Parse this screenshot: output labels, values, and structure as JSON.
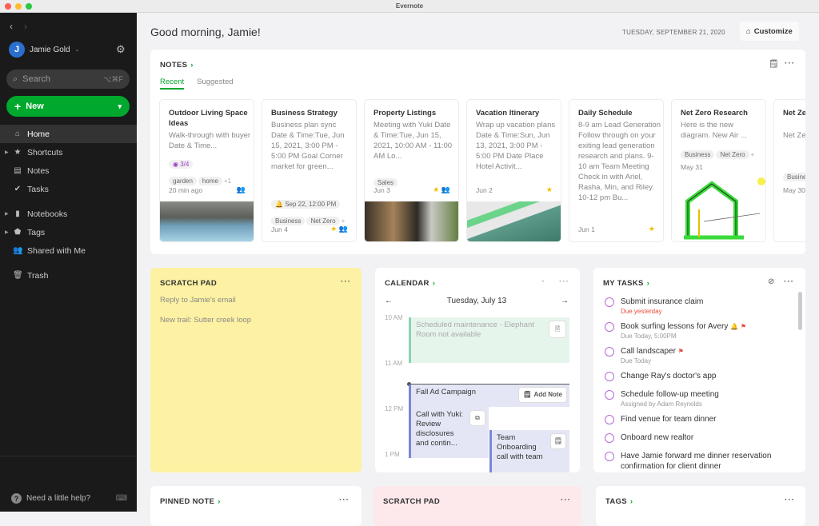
{
  "window": {
    "title": "Evernote"
  },
  "sidebar": {
    "user_initial": "J",
    "user_name": "Jamie Gold",
    "search_placeholder": "Search",
    "search_shortcut": "⌥⌘F",
    "new_label": "New",
    "items": [
      {
        "label": "Home",
        "icon": "home-icon"
      },
      {
        "label": "Shortcuts",
        "icon": "star-icon"
      },
      {
        "label": "Notes",
        "icon": "note-icon"
      },
      {
        "label": "Tasks",
        "icon": "check-circle-icon"
      },
      {
        "label": "Notebooks",
        "icon": "notebook-icon"
      },
      {
        "label": "Tags",
        "icon": "tag-icon"
      },
      {
        "label": "Shared with Me",
        "icon": "people-icon"
      },
      {
        "label": "Trash",
        "icon": "trash-icon"
      }
    ],
    "help_label": "Need a little help?"
  },
  "header": {
    "greeting": "Good morning, Jamie!",
    "date": "TUESDAY, SEPTEMBER 21, 2020",
    "customize_label": "Customize"
  },
  "notes": {
    "title": "NOTES",
    "tabs": [
      "Recent",
      "Suggested"
    ],
    "cards": [
      {
        "title": "Outdoor Living Space Ideas",
        "body": "Walk-through with buyer Date & Time...",
        "task_badge": "3/4",
        "tags": [
          "garden",
          "home"
        ],
        "more_tags": "+1",
        "date": "20 min ago"
      },
      {
        "title": "Business Strategy",
        "body": "Business plan sync Date & Time:Tue, Jun 15, 2021, 3:00 PM - 5:00 PM Goal Corner market for green...",
        "reminder": "Sep 22, 12:00 PM",
        "tags": [
          "Business",
          "Net Zero"
        ],
        "more_tags": "+",
        "date": "Jun 4"
      },
      {
        "title": "Property Listings",
        "body": "Meeting with Yuki Date & Time:Tue, Jun 15, 2021, 10:00 AM - 11:00 AM Lo...",
        "tags": [
          "Sales"
        ],
        "date": "Jun 3"
      },
      {
        "title": "Vacation Itinerary",
        "body": "Wrap up vacation plans Date & Time:Sun, Jun 13, 2021, 3:00 PM - 5:00 PM Date Place Hotel Activit...",
        "date": "Jun 2"
      },
      {
        "title": "Daily Schedule",
        "body": "8-9 am Lead Generation Follow through on your exiting lead generation research and plans. 9-10 am Team Meeting Check in with Ariel, Rasha, Min, and Riley. 10-12 pm Bu...",
        "date": "Jun 1"
      },
      {
        "title": "Net Zero Research",
        "body": "Here is the new diagram. New Air ...",
        "tags": [
          "Business",
          "Net Zero"
        ],
        "more_tags": "+",
        "date": "May 31"
      },
      {
        "title": "Net Zero Docum",
        "body": "Net Ze Docur Zero F",
        "tags": [
          "Busine"
        ],
        "date": "May 30"
      }
    ]
  },
  "scratch_pad": {
    "title": "SCRATCH PAD",
    "lines": [
      "Reply to Jamie's email",
      "New trail: Sutter creek loop"
    ]
  },
  "calendar": {
    "title": "CALENDAR",
    "day": "Tuesday, July 13",
    "hours": [
      "10 AM",
      "11 AM",
      "12 PM",
      "1 PM"
    ],
    "events": [
      {
        "title": "Scheduled maintenance - Elephant Room not available"
      },
      {
        "title": "Fall Ad Campaign",
        "action": "Add Note"
      },
      {
        "title": "Call with Yuki: Review disclosures and contin..."
      },
      {
        "title": "Team Onboarding call with team"
      }
    ]
  },
  "tasks": {
    "title": "MY TASKS",
    "items": [
      {
        "title": "Submit insurance claim",
        "sub": "Due yesterday",
        "overdue": true
      },
      {
        "title": "Book surfing lessons for Avery",
        "sub": "Due Today, 5:00PM",
        "reminder": true,
        "flag": true
      },
      {
        "title": "Call landscaper",
        "sub": "Due Today",
        "flag": true
      },
      {
        "title": "Change Ray's doctor's app"
      },
      {
        "title": "Schedule follow-up meeting",
        "sub": "Assigned by Adam Reynolds"
      },
      {
        "title": "Find venue for team dinner"
      },
      {
        "title": "Onboard new realtor"
      },
      {
        "title": "Have Jamie forward me dinner reservation confirmation for client dinner"
      }
    ]
  },
  "bottom_widgets": {
    "pinned_note": "PINNED NOTE",
    "scratch_pad": "SCRATCH PAD",
    "tags": "TAGS"
  },
  "colors": {
    "accent": "#00a82d",
    "scratch_yellow": "#fdf1a3",
    "scratch_pink": "#fde8ec",
    "task_circle": "#b66bd4"
  }
}
